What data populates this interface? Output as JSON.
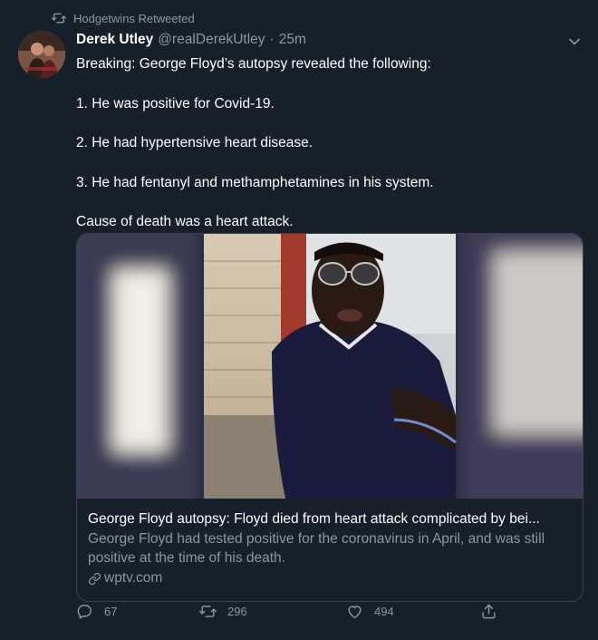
{
  "retweet_banner": {
    "icon": "retweet-icon",
    "text": "Hodgetwins Retweeted"
  },
  "author": {
    "display_name": "Derek Utley",
    "handle": "@realDerekUtley",
    "separator": "·",
    "time": "25m",
    "avatar_icon": "avatar"
  },
  "tweet": {
    "paragraphs": [
      "Breaking: George Floyd’s autopsy revealed the following:",
      "1. He was positive for Covid-19.",
      "2. He had hypertensive heart disease.",
      "3. He had fentanyl and methamphetamines in his system.",
      "Cause of death was a heart attack."
    ]
  },
  "card": {
    "title": "George Floyd autopsy: Floyd died from heart attack complicated by bei...",
    "description": "George Floyd had tested positive for the coronavirus in April, and was still positive at the time of his death.",
    "domain": "wptv.com",
    "link_icon": "link-icon"
  },
  "actions": {
    "reply_count": "67",
    "retweet_count": "296",
    "like_count": "494"
  },
  "colors": {
    "background": "#15202b",
    "secondary_text": "#8899a6",
    "border": "#38444d"
  }
}
